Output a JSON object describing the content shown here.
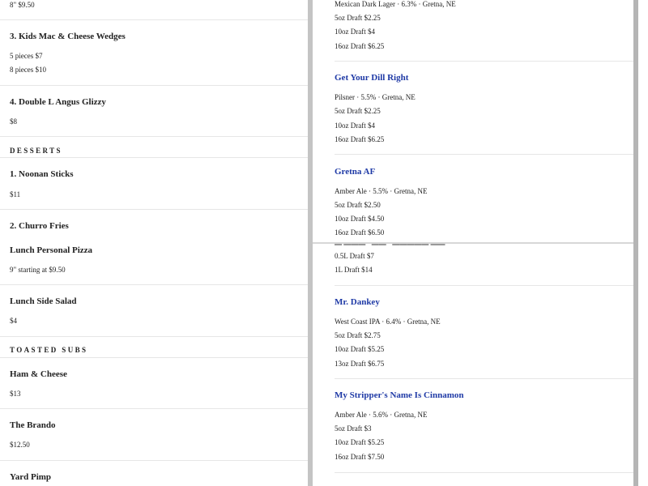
{
  "left_top": {
    "pizza_price_line": "8\" $9.50",
    "kids_item": {
      "title": "3. Kids Mac & Cheese Wedges",
      "opt1": "5 pieces $7",
      "opt2": "8 pieces $10"
    },
    "double_item": {
      "title": "4. Double L Angus Glizzy",
      "price": "$8"
    },
    "desserts_header": "DESSERTS",
    "noonan": {
      "title": "1. Noonan Sticks",
      "price": "$11"
    },
    "churro": {
      "title": "2. Churro Fries"
    }
  },
  "left_bottom": {
    "lunch_pizza": {
      "title": "Lunch Personal Pizza",
      "price": "9\" starting at $9.50"
    },
    "lunch_salad": {
      "title": "Lunch Side Salad",
      "price": "$4"
    },
    "toasted_header": "TOASTED SUBS",
    "ham": {
      "title": "Ham & Cheese",
      "price": "$13"
    },
    "brando": {
      "title": "The Brando",
      "price": "$12.50"
    },
    "yard": {
      "title": "Yard Pimp"
    }
  },
  "right_top": {
    "mexican": {
      "desc": "Mexican Dark Lager · 6.3% · Gretna, NE",
      "d5": "5oz Draft $2.25",
      "d10": "10oz Draft $4",
      "d16": "16oz Draft $6.25"
    },
    "dill": {
      "title": "Get Your Dill Right",
      "desc": "Pilsner · 5.5% · Gretna, NE",
      "d5": "5oz Draft $2.25",
      "d10": "10oz Draft $4",
      "d16": "16oz Draft $6.25"
    },
    "gretna": {
      "title": "Gretna AF",
      "desc": "Amber Ale · 5.5% · Gretna, NE",
      "d5": "5oz Draft $2.50",
      "d10": "10oz Draft $4.50",
      "d16": "16oz Draft $6.50"
    }
  },
  "right_bottom": {
    "liter": {
      "half": "0.5L Draft $7",
      "one": "1L Draft $14"
    },
    "dankey": {
      "title": "Mr. Dankey",
      "desc": "West Coast IPA · 6.4% · Gretna, NE",
      "d5": "5oz Draft $2.75",
      "d10": "10oz Draft $5.25",
      "d13": "13oz Draft $6.75"
    },
    "stripper": {
      "title": "My Stripper's Name Is Cinnamon",
      "desc": "Amber Ale · 5.6% · Gretna, NE",
      "d5": "5oz Draft $3",
      "d10": "10oz Draft $5.25",
      "d16": "16oz Draft $7.50"
    }
  }
}
